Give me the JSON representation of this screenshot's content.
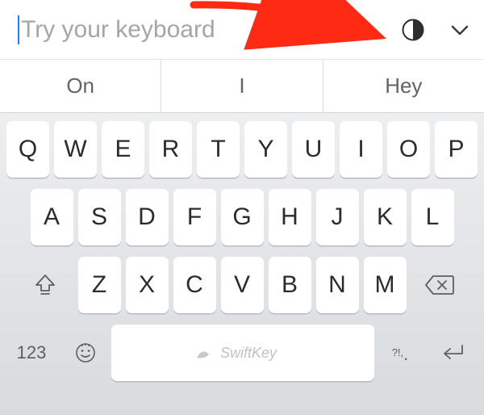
{
  "input": {
    "placeholder": "Try your keyboard",
    "value": ""
  },
  "topbar": {
    "theme_toggle_icon": "half-circle-theme-icon",
    "dropdown_icon": "chevron-down-icon"
  },
  "annotation": {
    "arrow_color": "#ff2a13"
  },
  "suggestions": [
    "On",
    "I",
    "Hey"
  ],
  "keyboard": {
    "row1": [
      "Q",
      "W",
      "E",
      "R",
      "T",
      "Y",
      "U",
      "I",
      "O",
      "P"
    ],
    "row2": [
      "A",
      "S",
      "D",
      "F",
      "G",
      "H",
      "J",
      "K",
      "L"
    ],
    "row3_letters": [
      "Z",
      "X",
      "C",
      "V",
      "B",
      "N",
      "M"
    ],
    "shift_icon": "shift-icon",
    "backspace_icon": "backspace-icon",
    "numbers_label": "123",
    "emoji_icon": "emoji-icon",
    "space_label": "SwiftKey",
    "punctuation_top": "?!,",
    "punctuation_bottom": ".",
    "return_icon": "return-icon"
  }
}
